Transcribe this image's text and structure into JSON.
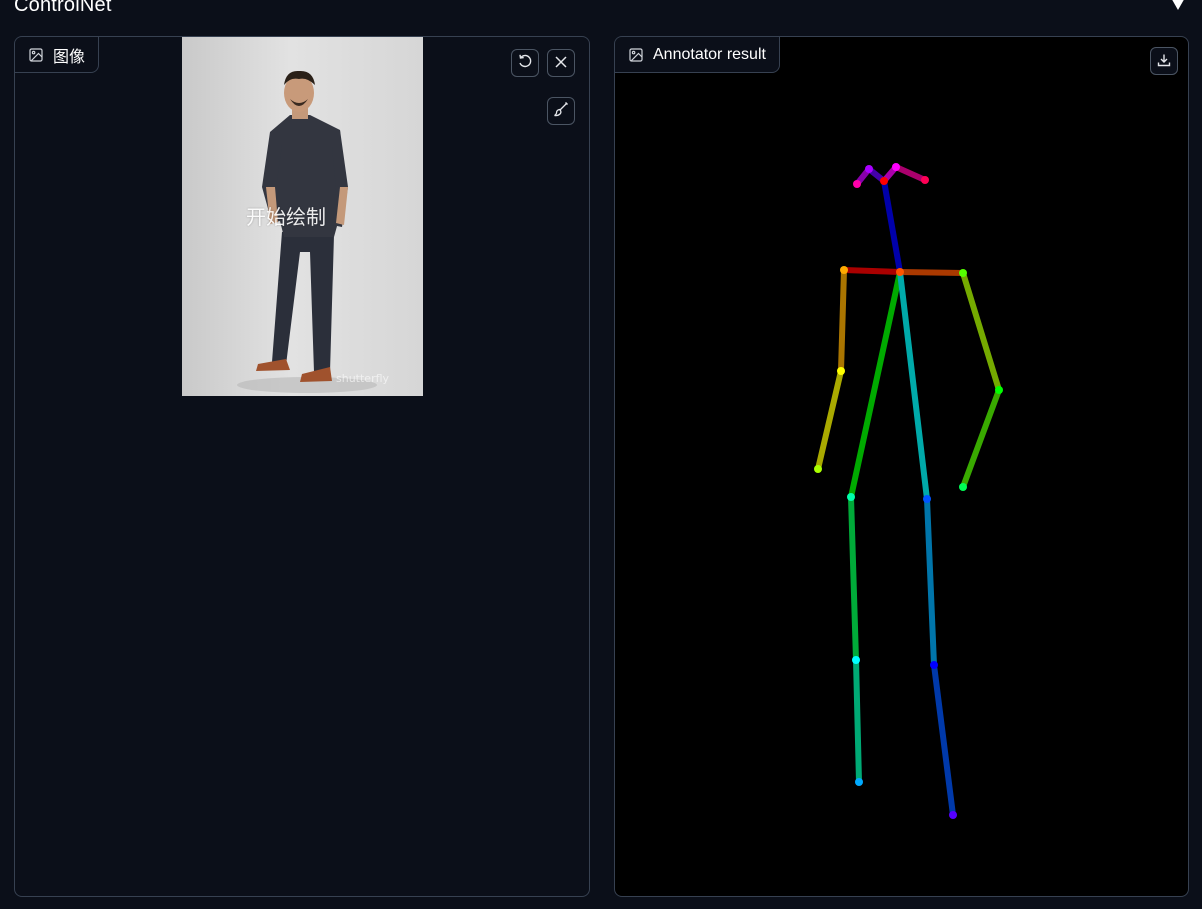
{
  "header": {
    "title": "ControlNet"
  },
  "input_panel": {
    "label": "图像",
    "label_icon": "image-icon",
    "overlay_text": "开始绘制",
    "watermark": "shutterfly",
    "buttons": [
      {
        "name": "undo-button",
        "icon": "undo-icon"
      },
      {
        "name": "clear-button",
        "icon": "close-icon"
      },
      {
        "name": "brush-button",
        "icon": "brush-icon"
      }
    ]
  },
  "output_panel": {
    "label": "Annotator result",
    "label_icon": "image-icon",
    "download_icon": "download-icon"
  },
  "colors": {
    "background": "#0b0f19",
    "panel_border": "#374151",
    "annotator_background": "#000000"
  }
}
